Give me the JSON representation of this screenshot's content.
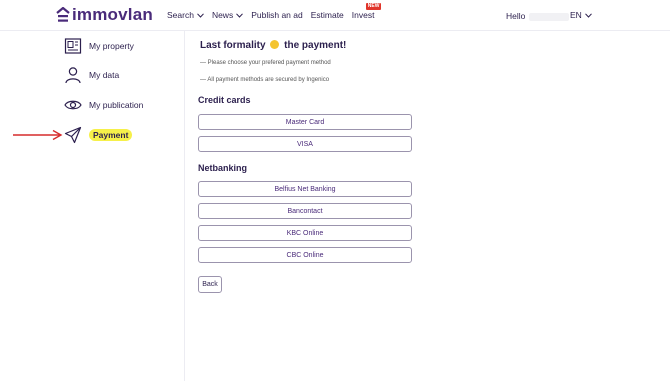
{
  "header": {
    "brand": "immovlan",
    "nav": [
      {
        "label": "Search"
      },
      {
        "label": "News"
      },
      {
        "label": "Publish an ad"
      },
      {
        "label": "Estimate"
      },
      {
        "label": "Invest",
        "badge": "NEW"
      }
    ],
    "greeting": "Hello",
    "language": "EN"
  },
  "sidebar": {
    "items": [
      {
        "label": "My property",
        "icon": "building-icon"
      },
      {
        "label": "My data",
        "icon": "user-icon"
      },
      {
        "label": "My publication",
        "icon": "eye-icon"
      },
      {
        "label": "Payment",
        "icon": "paper-plane-icon",
        "active": true
      }
    ]
  },
  "main": {
    "title_pre": "Last formality",
    "title_post": "the payment!",
    "note1": "— Please choose your prefered payment method",
    "note2": "— All payment methods are secured by Ingenico",
    "credit_cards_heading": "Credit cards",
    "credit_cards": [
      "Master Card",
      "VISA"
    ],
    "netbanking_heading": "Netbanking",
    "netbanking": [
      "Belfius Net Banking",
      "Bancontact",
      "KBC Online",
      "CBC Online"
    ],
    "back_label": "Back"
  },
  "colors": {
    "brand": "#4a2b7a",
    "highlight": "#f6f04a",
    "annotation_arrow": "#d62c2c",
    "badge": "#e0352b"
  }
}
